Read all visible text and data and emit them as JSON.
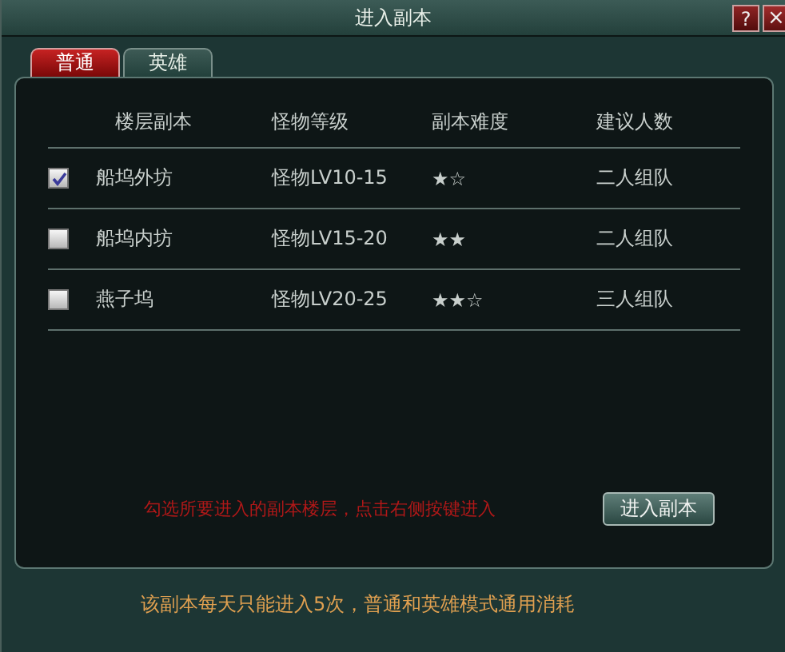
{
  "window": {
    "title": "进入副本",
    "buttons": [
      {
        "kind": "help",
        "label": "?"
      },
      {
        "kind": "close",
        "label": "×"
      }
    ]
  },
  "tabs": [
    {
      "label": "普通",
      "selected": true
    },
    {
      "label": "英雄",
      "selected": false
    }
  ],
  "table": {
    "columns": [
      "楼层副本",
      "怪物等级",
      "副本难度",
      "建议人数"
    ],
    "rows": [
      {
        "checked": true,
        "cells": [
          "船坞外坊",
          "怪物LV10-15",
          "★☆",
          "二人组队"
        ]
      },
      {
        "checked": false,
        "cells": [
          "船坞内坊",
          "怪物LV15-20",
          "★★",
          "二人组队"
        ]
      },
      {
        "checked": false,
        "cells": [
          "燕子坞",
          "怪物LV20-25",
          "★★☆",
          "三人组队"
        ]
      }
    ]
  },
  "hint": "勾选所要进入的副本楼层，点击右侧按键进入",
  "enter_button": "进入副本",
  "footer": "该副本每天只能进入5次，普通和英雄模式通用消耗"
}
